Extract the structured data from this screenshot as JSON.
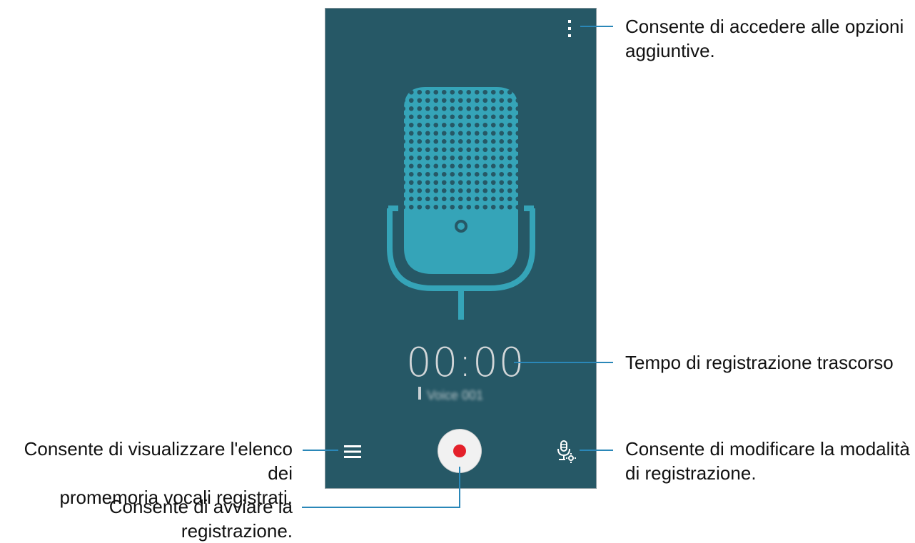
{
  "timer": "00:00",
  "recording_name": "Voice 001",
  "callouts": {
    "more_options": [
      "Consente di accedere alle opzioni",
      "aggiuntive."
    ],
    "elapsed_time": "Tempo di registrazione trascorso",
    "list": [
      "Consente di visualizzare l'elenco dei",
      "promemoria vocali registrati."
    ],
    "recording_mode": [
      "Consente di modificare la modalità",
      "di registrazione."
    ],
    "start_recording": "Consente di avviare la registrazione."
  },
  "colors": {
    "screen_bg": "#265866",
    "microphone": "#35a4b8",
    "record_dot": "#e4202a",
    "callout_line": "#2a87b8"
  },
  "icons": [
    "more-options-icon",
    "microphone-illustration",
    "list-icon",
    "record-icon",
    "recording-mode-icon"
  ]
}
